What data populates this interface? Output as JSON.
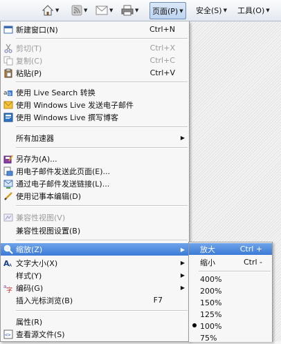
{
  "toolbar": {
    "page_label": "页面(P)",
    "safety_label": "安全(S)",
    "tools_label": "工具(O)"
  },
  "main_menu": {
    "new_window": "新建窗口(N)",
    "new_window_sc": "Ctrl+N",
    "cut": "剪切(T)",
    "cut_sc": "Ctrl+X",
    "copy": "复制(C)",
    "copy_sc": "Ctrl+C",
    "paste": "粘贴(P)",
    "paste_sc": "Ctrl+V",
    "live_translate": "使用 Live Search 转换",
    "live_mail": "使用 Windows Live 发送电子邮件",
    "live_blog": "使用 Windows Live 撰写博客",
    "all_accelerators": "所有加速器",
    "save_as": "另存为(A)...",
    "email_page": "用电子邮件发送此页面(E)...",
    "email_link": "通过电子邮件发送链接(L)...",
    "edit_notepad": "使用记事本编辑(D)",
    "compat_view": "兼容性视图(V)",
    "compat_settings": "兼容性视图设置(B)",
    "zoom": "缩放(Z)",
    "text_size": "文字大小(X)",
    "style": "样式(Y)",
    "encoding": "编码(G)",
    "caret_browsing": "插入光标浏览(B)",
    "caret_browsing_sc": "F7",
    "properties": "属性(R)",
    "view_source": "查看源文件(S)"
  },
  "zoom_menu": {
    "zoom_in": "放大",
    "zoom_in_sc": "Ctrl +",
    "zoom_out": "缩小",
    "zoom_out_sc": "Ctrl -",
    "z400": "400%",
    "z200": "200%",
    "z150": "150%",
    "z125": "125%",
    "z100": "100%",
    "z75": "75%"
  },
  "colors": {
    "highlight": "#3b7ad6",
    "disabled_text": "#9b9b9b"
  }
}
